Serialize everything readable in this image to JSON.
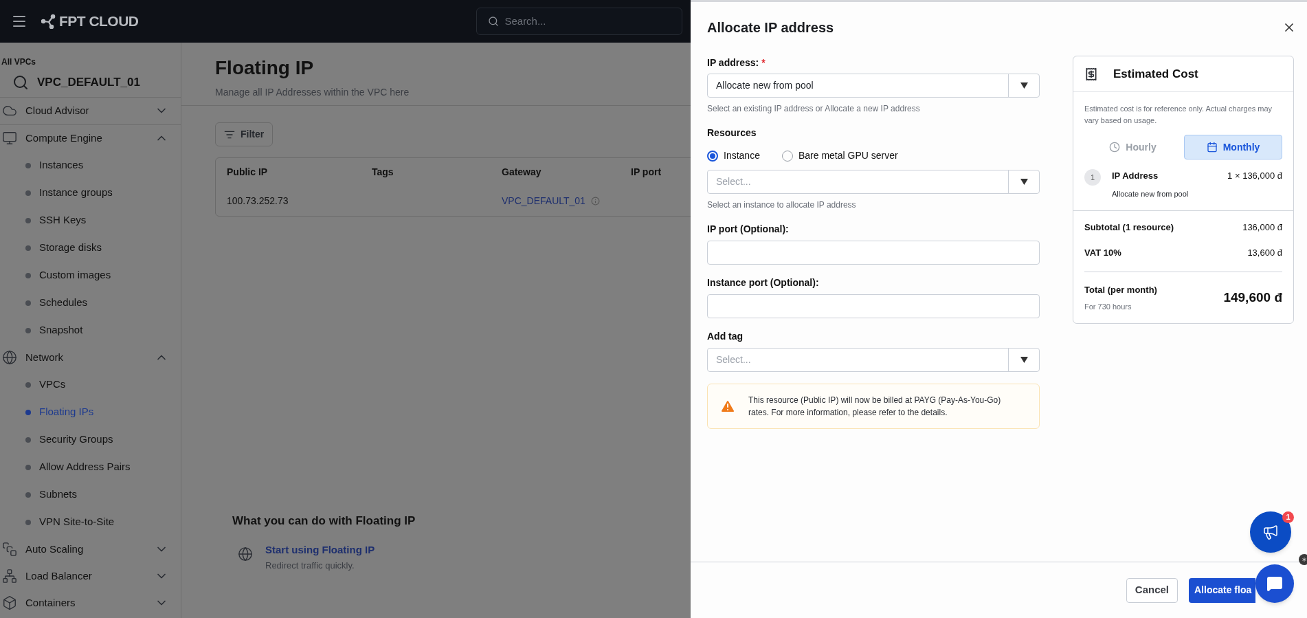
{
  "topbar": {
    "logo": "FPT CLOUD",
    "search": {
      "placeholder": "Search..."
    }
  },
  "sidebar": {
    "scope_label": "All VPCs",
    "vpc": "VPC_DEFAULT_01",
    "groups": [
      {
        "label": "Cloud Advisor",
        "expanded": false
      },
      {
        "label": "Compute Engine",
        "expanded": true,
        "children": [
          {
            "label": "Instances",
            "selected": false
          },
          {
            "label": "Instance groups",
            "selected": false
          },
          {
            "label": "SSH Keys",
            "selected": false
          },
          {
            "label": "Storage disks",
            "selected": false
          },
          {
            "label": "Custom images",
            "selected": false
          },
          {
            "label": "Schedules",
            "selected": false
          },
          {
            "label": "Snapshot",
            "selected": false
          }
        ]
      },
      {
        "label": "Network",
        "expanded": true,
        "children": [
          {
            "label": "VPCs",
            "selected": false
          },
          {
            "label": "Floating IPs",
            "selected": true
          },
          {
            "label": "Security Groups",
            "selected": false
          },
          {
            "label": "Allow Address Pairs",
            "selected": false
          },
          {
            "label": "Subnets",
            "selected": false
          },
          {
            "label": "VPN Site-to-Site",
            "selected": false
          }
        ]
      },
      {
        "label": "Auto Scaling",
        "expanded": false
      },
      {
        "label": "Load Balancer",
        "expanded": false
      },
      {
        "label": "Containers",
        "expanded": false
      }
    ]
  },
  "page": {
    "title": "Floating IP",
    "subtitle": "Manage all IP Addresses within the VPC here",
    "filter_button": "Filter",
    "table": {
      "columns": [
        "Public IP",
        "Tags",
        "Gateway",
        "IP port"
      ],
      "rows": [
        {
          "public_ip": "100.73.252.73",
          "gateway": "VPC_DEFAULT_01"
        }
      ]
    },
    "guide": {
      "title": "What you can do with Floating IP",
      "items": [
        {
          "title": "Start using Floating IP",
          "description": "Redirect traffic quickly."
        }
      ]
    }
  },
  "drawer": {
    "title": "Allocate IP address",
    "ip_address": {
      "label": "IP address:",
      "required_mark": "*",
      "value": "Allocate new from pool",
      "help": "Select an existing IP address or Allocate a new IP address"
    },
    "resources": {
      "label": "Resources",
      "options": [
        {
          "label": "Instance",
          "selected": true
        },
        {
          "label": "Bare metal GPU server",
          "selected": false
        }
      ],
      "placeholder": "Select...",
      "help": "Select an instance to allocate IP address"
    },
    "ip_port": {
      "label": "IP port (Optional):"
    },
    "instance_port": {
      "label": "Instance port (Optional):"
    },
    "add_tag": {
      "label": "Add tag",
      "placeholder": "Select..."
    },
    "notice": "This resource (Public IP) will now be billed at PAYG (Pay-As-You-Go) rates. For more information, please refer to the details.",
    "cost": {
      "title": "Estimated Cost",
      "note": "Estimated cost is for reference only. Actual charges may vary based on usage.",
      "periods": [
        {
          "label": "Hourly",
          "selected": false
        },
        {
          "label": "Monthly",
          "selected": true
        }
      ],
      "items": [
        {
          "index": "1",
          "name": "IP Address",
          "price": "1 × 136,000 đ",
          "description": "Allocate new from pool"
        }
      ],
      "subtotal": {
        "label": "Subtotal (1 resource)",
        "value": "136,000 đ"
      },
      "vat": {
        "label": "VAT 10%",
        "value": "13,600 đ"
      },
      "total": {
        "label": "Total (per month)",
        "note": "For 730 hours",
        "value": "149,600 đ"
      }
    },
    "buttons": [
      {
        "label": "Cancel",
        "kind": "secondary"
      },
      {
        "label": "Allocate floa",
        "kind": "primary"
      }
    ]
  },
  "widgets": {
    "announcement_badge": "1"
  }
}
